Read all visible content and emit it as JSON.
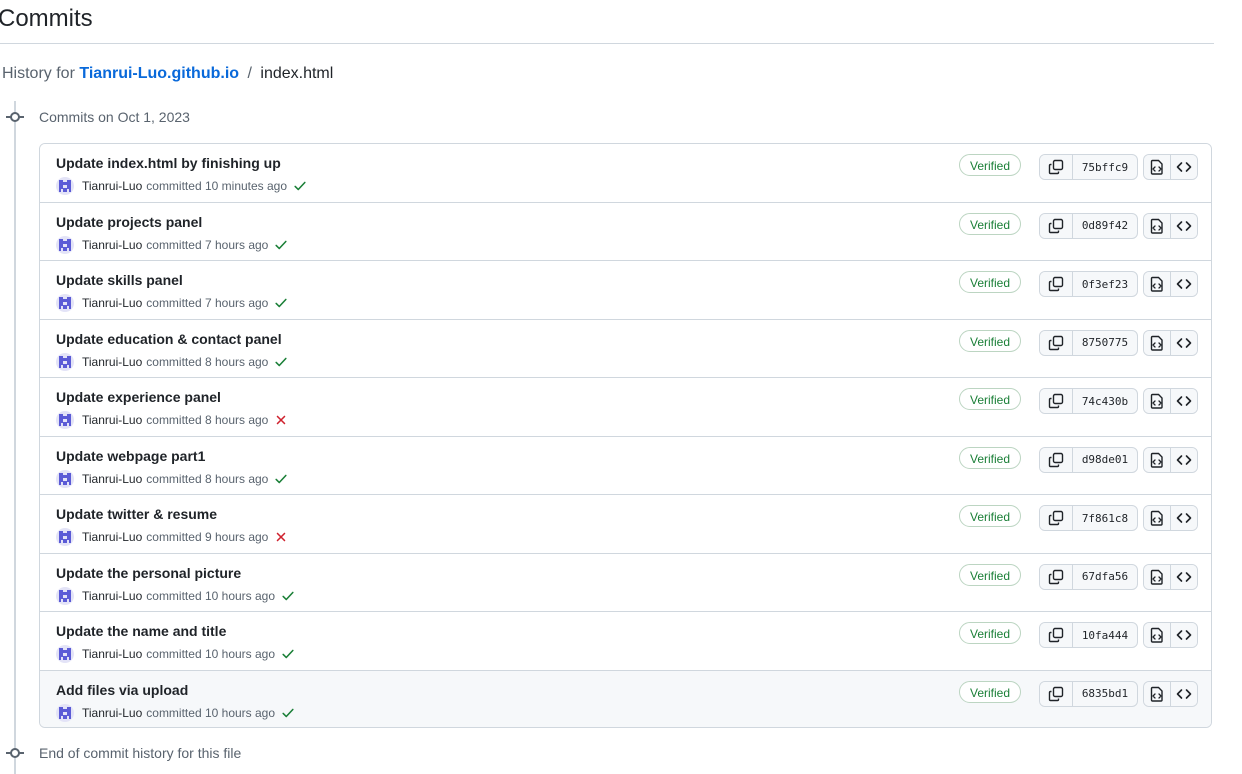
{
  "header": {
    "title": "Commits"
  },
  "breadcrumb": {
    "prefix": "History for",
    "repo": "Tianrui-Luo.github.io",
    "separator": "/",
    "file": "index.html"
  },
  "group": {
    "label": "Commits on Oct 1, 2023"
  },
  "footer": {
    "label": "End of commit history for this file"
  },
  "colors": {
    "link": "#0969da",
    "success": "#1a7f37",
    "failure": "#cf222e",
    "border": "#d0d7de",
    "muted": "#59636e"
  },
  "commits": [
    {
      "message": "Update index.html by finishing up",
      "author": "Tianrui-Luo",
      "action": "committed",
      "time": "10 minutes ago",
      "status": "success",
      "verified": "Verified",
      "sha": "75bffc9"
    },
    {
      "message": "Update projects panel",
      "author": "Tianrui-Luo",
      "action": "committed",
      "time": "7 hours ago",
      "status": "success",
      "verified": "Verified",
      "sha": "0d89f42"
    },
    {
      "message": "Update skills panel",
      "author": "Tianrui-Luo",
      "action": "committed",
      "time": "7 hours ago",
      "status": "success",
      "verified": "Verified",
      "sha": "0f3ef23"
    },
    {
      "message": "Update education & contact panel",
      "author": "Tianrui-Luo",
      "action": "committed",
      "time": "8 hours ago",
      "status": "success",
      "verified": "Verified",
      "sha": "8750775"
    },
    {
      "message": "Update experience panel",
      "author": "Tianrui-Luo",
      "action": "committed",
      "time": "8 hours ago",
      "status": "failure",
      "verified": "Verified",
      "sha": "74c430b"
    },
    {
      "message": "Update webpage part1",
      "author": "Tianrui-Luo",
      "action": "committed",
      "time": "8 hours ago",
      "status": "success",
      "verified": "Verified",
      "sha": "d98de01"
    },
    {
      "message": "Update twitter & resume",
      "author": "Tianrui-Luo",
      "action": "committed",
      "time": "9 hours ago",
      "status": "failure",
      "verified": "Verified",
      "sha": "7f861c8"
    },
    {
      "message": "Update the personal picture",
      "author": "Tianrui-Luo",
      "action": "committed",
      "time": "10 hours ago",
      "status": "success",
      "verified": "Verified",
      "sha": "67dfa56"
    },
    {
      "message": "Update the name and title",
      "author": "Tianrui-Luo",
      "action": "committed",
      "time": "10 hours ago",
      "status": "success",
      "verified": "Verified",
      "sha": "10fa444"
    },
    {
      "message": "Add files via upload",
      "author": "Tianrui-Luo",
      "action": "committed",
      "time": "10 hours ago",
      "status": "success",
      "verified": "Verified",
      "sha": "6835bd1"
    }
  ],
  "icons": {
    "copy": "copy-icon",
    "browse_files": "file-code-icon",
    "browse_repo": "code-icon",
    "success": "check-icon",
    "failure": "x-icon",
    "timeline": "git-commit-icon"
  }
}
